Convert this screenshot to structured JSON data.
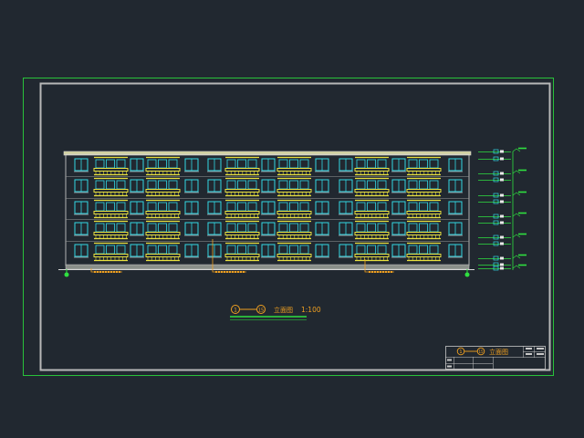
{
  "drawing": {
    "caption_start": "1",
    "caption_end": "15",
    "caption_title": "立面图",
    "caption_scale": "1:100",
    "title_block": {
      "start": "1",
      "end": "15",
      "name": "立面图"
    }
  },
  "colors": {
    "background": "#212830",
    "outer_border": "#29c23a",
    "inner_border": "#b8b8b8",
    "building_outline": "#d8d8d8",
    "balcony": "#e8e040",
    "window": "#32d8e4",
    "annotation": "#f0a020",
    "level_mark": "#2fe040"
  }
}
